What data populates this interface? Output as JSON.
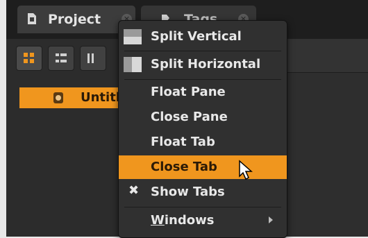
{
  "tabs": [
    {
      "label": "Project",
      "icon": "document-icon",
      "close": "✕"
    },
    {
      "label": "Tags",
      "icon": "tag-icon",
      "close": "✕"
    }
  ],
  "left_pane": {
    "toolbar": [
      "grid-view-icon",
      "list-view-icon",
      "columns-view-icon"
    ],
    "selected_row": {
      "label": "Untitl",
      "icon": "file-icon"
    }
  },
  "menu": {
    "items": [
      {
        "label": "Split Vertical",
        "icon": "split-vertical-icon"
      },
      {
        "label": "Split Horizontal",
        "icon": "split-horizontal-icon"
      },
      {
        "label": "Float Pane"
      },
      {
        "label": "Close Pane"
      },
      {
        "label": "Float Tab"
      },
      {
        "label": "Close Tab",
        "highlighted": true
      },
      {
        "label": "Show Tabs",
        "checked": true,
        "check_glyph": "✖"
      },
      {
        "label": "Windows",
        "mnemonic": "W",
        "rest": "indows",
        "submenu": true
      }
    ]
  },
  "colors": {
    "accent": "#f0961e",
    "menu_bg": "#303030",
    "app_bg": "#2a2a2a"
  }
}
